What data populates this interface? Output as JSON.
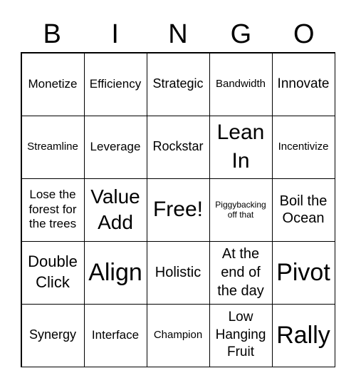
{
  "header": [
    "B",
    "I",
    "N",
    "G",
    "O"
  ],
  "cells": [
    "Monetize",
    "Efficiency",
    "Strategic",
    "Bandwidth",
    "Innovate",
    "Streamline",
    "Leverage",
    "Rockstar",
    "Lean In",
    "Incentivize",
    "Lose the forest for the trees",
    "Value Add",
    "Free!",
    "Piggybacking off that",
    "Boil the Ocean",
    "Double Click",
    "Align",
    "Holistic",
    "At the end of the day",
    "Pivot",
    "Synergy",
    "Interface",
    "Champion",
    "Low Hanging Fruit",
    "Rally"
  ]
}
